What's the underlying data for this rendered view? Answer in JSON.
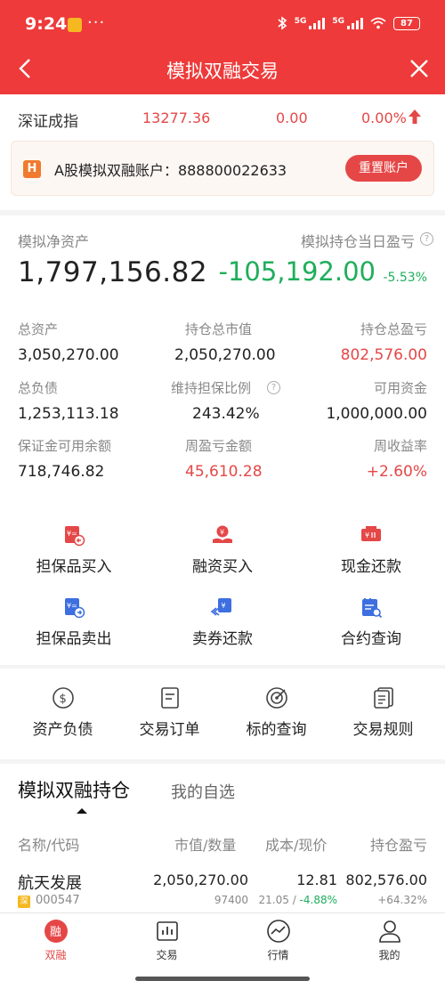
{
  "status_bar": {
    "time": "9:24",
    "dots": "···",
    "net1": "5G",
    "net2": "5G",
    "battery": "87"
  },
  "nav": {
    "title": "模拟双融交易"
  },
  "index": {
    "name": "深证成指",
    "price": "13277.36",
    "change": "0.00",
    "pct": "0.00%"
  },
  "account": {
    "icon_text": "H",
    "label": "A股模拟双融账户：888800022633",
    "reset_label": "重置账户"
  },
  "summary": {
    "net_label": "模拟净资产",
    "net_value": "1,797,156.82",
    "pl_label": "模拟持仓当日盈亏",
    "pl_value": "-105,192.00",
    "pl_pct": "-5.53%",
    "stats": [
      {
        "label": "总资产",
        "value": "3,050,270.00"
      },
      {
        "label": "持仓总市值",
        "value": "2,050,270.00"
      },
      {
        "label": "持仓总盈亏",
        "value": "802,576.00"
      },
      {
        "label": "总负债",
        "value": "1,253,113.18"
      },
      {
        "label": "维持担保比例",
        "value": "243.42%"
      },
      {
        "label": "可用资金",
        "value": "1,000,000.00"
      },
      {
        "label": "保证金可用余额",
        "value": "718,746.82"
      },
      {
        "label": "周盈亏金额",
        "value": "45,610.28"
      },
      {
        "label": "周收益率",
        "value": "+2.60%"
      }
    ]
  },
  "actions": [
    {
      "label": "担保品买入",
      "icon": "collateral-buy-icon"
    },
    {
      "label": "融资买入",
      "icon": "margin-buy-icon"
    },
    {
      "label": "现金还款",
      "icon": "cash-repay-icon"
    },
    {
      "label": "担保品卖出",
      "icon": "collateral-sell-icon"
    },
    {
      "label": "卖券还款",
      "icon": "sell-repay-icon"
    },
    {
      "label": "合约查询",
      "icon": "contract-query-icon"
    }
  ],
  "tools": [
    {
      "label": "资产负债",
      "icon": "dollar-circle-icon"
    },
    {
      "label": "交易订单",
      "icon": "order-doc-icon"
    },
    {
      "label": "标的查询",
      "icon": "target-icon"
    },
    {
      "label": "交易规则",
      "icon": "rules-doc-icon"
    }
  ],
  "holdings": {
    "tab_active": "模拟双融持仓",
    "tab_inactive": "我的自选",
    "columns": [
      "名称/代码",
      "市值/数量",
      "成本/现价",
      "持仓盈亏"
    ],
    "rows": [
      {
        "name": "航天发展",
        "market_badge": "深",
        "code": "000547",
        "market_value": "2,050,270.00",
        "quantity": "97400",
        "cost": "12.81",
        "current_price": "21.05",
        "price_pct": "-4.88%",
        "pl": "802,576.00",
        "pl_pct": "+64.32%"
      }
    ]
  },
  "tabbar": [
    {
      "label": "双融",
      "icon": "rong-icon",
      "active": true
    },
    {
      "label": "交易",
      "icon": "chart-bars-icon",
      "active": false
    },
    {
      "label": "行情",
      "icon": "market-trend-icon",
      "active": false
    },
    {
      "label": "我的",
      "icon": "user-icon",
      "active": false
    }
  ],
  "colors": {
    "brand_red": "#ee3a3a",
    "up_red": "#e54747",
    "down_green": "#1fae5b"
  }
}
